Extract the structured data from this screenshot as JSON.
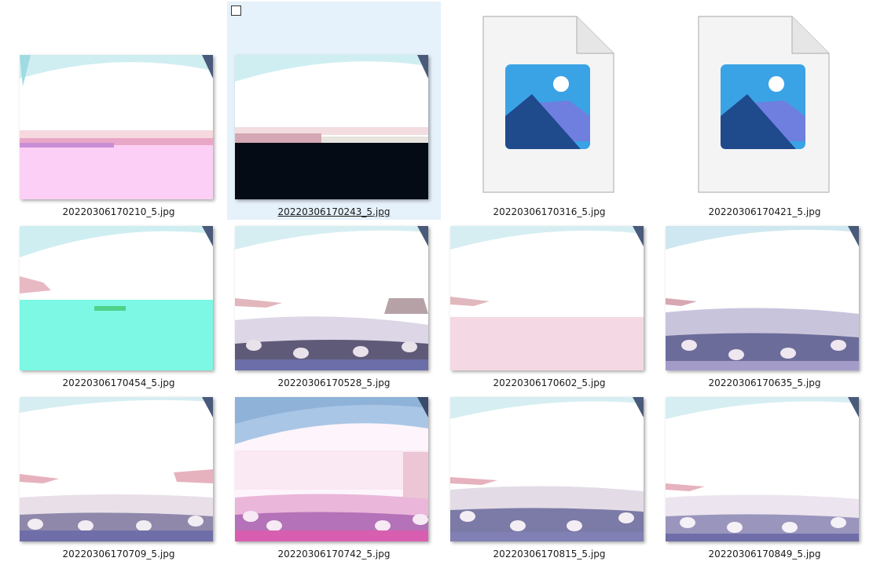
{
  "files": [
    {
      "name": "20220306170210_5.jpg",
      "kind": "photo",
      "icon": "image-thumbnail"
    },
    {
      "name": "20220306170243_5.jpg",
      "kind": "photo",
      "icon": "image-thumbnail",
      "selected": true
    },
    {
      "name": "20220306170316_5.jpg",
      "kind": "placeholder",
      "icon": "image-file-icon"
    },
    {
      "name": "20220306170421_5.jpg",
      "kind": "placeholder",
      "icon": "image-file-icon"
    },
    {
      "name": "20220306170454_5.jpg",
      "kind": "photo",
      "icon": "image-thumbnail"
    },
    {
      "name": "20220306170528_5.jpg",
      "kind": "photo",
      "icon": "image-thumbnail"
    },
    {
      "name": "20220306170602_5.jpg",
      "kind": "photo",
      "icon": "image-thumbnail"
    },
    {
      "name": "20220306170635_5.jpg",
      "kind": "photo",
      "icon": "image-thumbnail"
    },
    {
      "name": "20220306170709_5.jpg",
      "kind": "photo",
      "icon": "image-thumbnail"
    },
    {
      "name": "20220306170742_5.jpg",
      "kind": "photo",
      "icon": "image-thumbnail"
    },
    {
      "name": "20220306170815_5.jpg",
      "kind": "photo",
      "icon": "image-thumbnail"
    },
    {
      "name": "20220306170849_5.jpg",
      "kind": "photo",
      "icon": "image-thumbnail"
    }
  ],
  "colors": {
    "selection_bg": "#e5f1fb",
    "caption_text": "#1a1a1a"
  }
}
